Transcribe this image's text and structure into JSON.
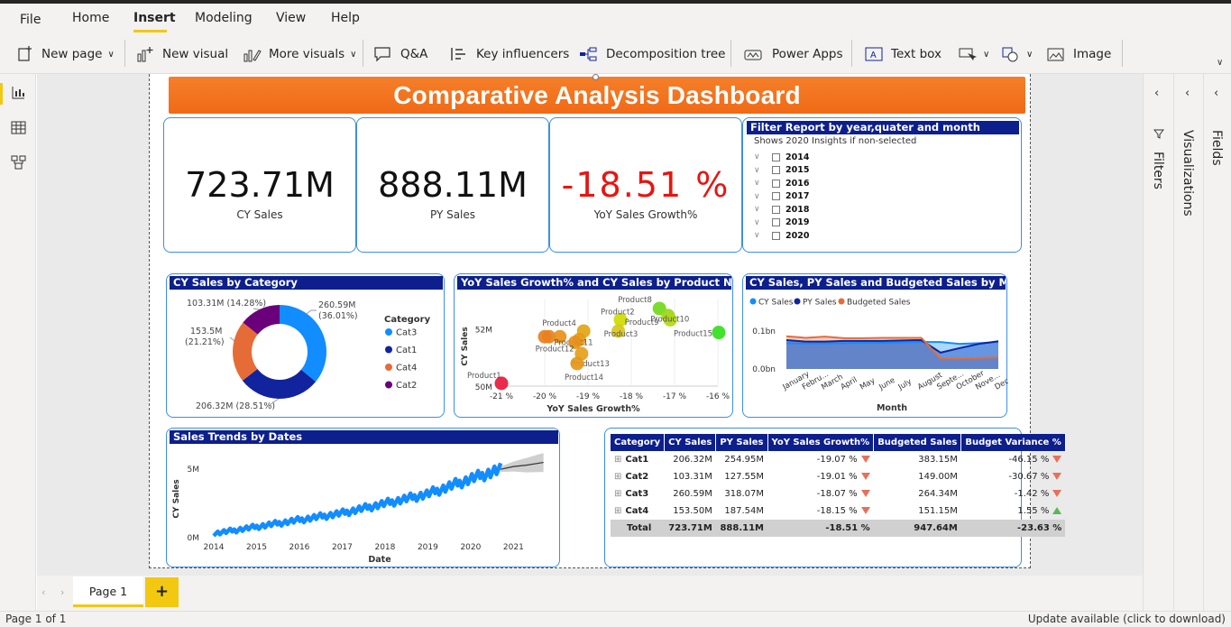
{
  "menu": {
    "file": "File",
    "home": "Home",
    "insert": "Insert",
    "modeling": "Modeling",
    "view": "View",
    "help": "Help"
  },
  "ribbon": {
    "new_page": "New page",
    "new_visual": "New visual",
    "more_visuals": "More visuals",
    "qa": "Q&A",
    "key_influencers": "Key influencers",
    "decomposition_tree": "Decomposition tree",
    "power_apps": "Power Apps",
    "text_box": "Text box",
    "image": "Image"
  },
  "dashboard": {
    "title": "Comparative Analysis Dashboard"
  },
  "kpis": {
    "cy": {
      "value": "723.71M",
      "label": "CY Sales"
    },
    "py": {
      "value": "888.11M",
      "label": "PY Sales"
    },
    "yoy": {
      "value": "-18.51 %",
      "label": "YoY Sales Growth%",
      "color": "#e8150f"
    }
  },
  "filter": {
    "title": "Filter Report by year,quater and month",
    "subtitle": "Shows 2020 Insights if non-selected",
    "years": [
      "2014",
      "2015",
      "2016",
      "2017",
      "2018",
      "2019",
      "2020"
    ]
  },
  "donut": {
    "title": "CY Sales by Category",
    "legend_title": "Category",
    "labels": {
      "cat2_a": "103.31M (14.28%)",
      "cat3_a": "260.59M",
      "cat3_b": "(36.01%)",
      "cat4_a": "153.5M",
      "cat4_b": "(21.21%)",
      "cat1_a": "206.32M (28.51%)"
    }
  },
  "scatter": {
    "title": "YoY Sales Growth% and CY Sales by Product Name",
    "xlabel": "YoY Sales Growth%",
    "ylabel": "CY Sales"
  },
  "area": {
    "title": "CY Sales, PY Sales and Budgeted Sales by Month",
    "xlabel": "Month"
  },
  "line": {
    "title": "Sales Trends by Dates",
    "xlabel": "Date",
    "ylabel": "CY Sales"
  },
  "chart_data": [
    {
      "type": "pie",
      "categories": [
        "Cat3",
        "Cat1",
        "Cat4",
        "Cat2"
      ],
      "values": [
        260.59,
        206.32,
        153.5,
        103.31
      ],
      "percents": [
        36.01,
        28.51,
        21.21,
        14.28
      ],
      "colors": [
        "#118dff",
        "#12239e",
        "#e66c37",
        "#6b007b"
      ],
      "title": "CY Sales by Category",
      "legend_title": "Category"
    },
    {
      "type": "scatter",
      "title": "YoY Sales Growth% and CY Sales by Product Name",
      "xlabel": "YoY Sales Growth%",
      "ylabel": "CY Sales",
      "xticks": [
        "-21 %",
        "-20 %",
        "-19 %",
        "-18 %",
        "-17 %",
        "-16 %"
      ],
      "yticks": [
        "50M",
        "52M"
      ],
      "xlim": [
        -21,
        -16
      ],
      "ylim": [
        50,
        53.1
      ],
      "points": [
        {
          "name": "Product1",
          "x": -21.0,
          "y": 50.1,
          "color": "#e8193c",
          "label": true
        },
        {
          "name": "Product2",
          "x": -18.25,
          "y": 52.35,
          "color": "#cddc00",
          "label": true
        },
        {
          "name": "Product3",
          "x": -18.3,
          "y": 51.95,
          "color": "#d9c51c",
          "label": true
        },
        {
          "name": "Product4",
          "x": -19.1,
          "y": 51.95,
          "color": "#e2a616",
          "label": true
        },
        {
          "name": "Product5",
          "x": -20.0,
          "y": 51.75,
          "color": "#e8801f",
          "label": false
        },
        {
          "name": "Product6",
          "x": -19.9,
          "y": 51.75,
          "color": "#e8801f",
          "label": false
        },
        {
          "name": "Product7",
          "x": -19.65,
          "y": 51.75,
          "color": "#e8901a",
          "label": false
        },
        {
          "name": "Product8",
          "x": -17.35,
          "y": 52.75,
          "color": "#70d91a",
          "label": true
        },
        {
          "name": "Product9",
          "x": -17.15,
          "y": 52.5,
          "color": "#9ad61a",
          "label": true
        },
        {
          "name": "Product10",
          "x": -17.1,
          "y": 52.35,
          "color": "#b2d719",
          "label": true
        },
        {
          "name": "Product11",
          "x": -19.2,
          "y": 51.65,
          "color": "#e59a18",
          "label": true
        },
        {
          "name": "Product12",
          "x": -19.3,
          "y": 51.55,
          "color": "#e8901a",
          "label": true
        },
        {
          "name": "Product13",
          "x": -19.15,
          "y": 51.15,
          "color": "#e59f18",
          "label": true
        },
        {
          "name": "Product14",
          "x": -19.25,
          "y": 50.8,
          "color": "#e59818",
          "label": true
        },
        {
          "name": "Product15",
          "x": -15.95,
          "y": 51.9,
          "color": "#33e01c",
          "label": true
        }
      ]
    },
    {
      "type": "area",
      "title": "CY Sales, PY Sales and Budgeted Sales by Month",
      "categories": [
        "January",
        "Febru...",
        "March",
        "April",
        "May",
        "June",
        "July",
        "August",
        "Septe...",
        "October",
        "Nove...",
        "Dece..."
      ],
      "yticks": [
        "0.0bn",
        "0.1bn"
      ],
      "ylim": [
        0,
        0.14
      ],
      "series": [
        {
          "name": "CY Sales",
          "color": "#118dff",
          "values": [
            0.068,
            0.067,
            0.067,
            0.068,
            0.069,
            0.069,
            0.07,
            0.071,
            0.071,
            0.066,
            0.068,
            0.071
          ]
        },
        {
          "name": "PY Sales",
          "color": "#12239e",
          "values": [
            0.076,
            0.072,
            0.072,
            0.074,
            0.074,
            0.074,
            0.075,
            0.076,
            0.043,
            0.055,
            0.066,
            0.073
          ]
        },
        {
          "name": "Budgeted Sales",
          "color": "#e66c37",
          "values": [
            0.086,
            0.082,
            0.085,
            0.081,
            0.081,
            0.082,
            0.082,
            0.082,
            0.028,
            0.028,
            0.029,
            0.031
          ]
        }
      ],
      "xlabel": "Month"
    },
    {
      "type": "line",
      "title": "Sales Trends by Dates",
      "xlabel": "Date",
      "ylabel": "CY Sales",
      "xticks": [
        "2014",
        "2015",
        "2016",
        "2017",
        "2018",
        "2019",
        "2020",
        "2021"
      ],
      "yticks": [
        "0M",
        "5M"
      ],
      "series": [
        {
          "name": "CY Sales",
          "color": "#118dff",
          "x": [
            2014.0,
            2015.0,
            2016.0,
            2017.0,
            2018.0,
            2019.0,
            2020.0,
            2020.7
          ],
          "values": [
            0.3,
            0.8,
            1.3,
            1.8,
            2.5,
            3.2,
            4.3,
            5.0
          ]
        },
        {
          "name": "Forecast",
          "color": "#333333",
          "x": [
            2020.7,
            2021.0,
            2021.3,
            2021.7
          ],
          "values": [
            5.0,
            5.2,
            5.3,
            5.5
          ]
        }
      ]
    },
    {
      "type": "table",
      "columns": [
        "Category",
        "CY Sales",
        "PY Sales",
        "YoY Sales Growth%",
        "Budgeted Sales",
        "Budget Variance %"
      ],
      "rows": [
        {
          "cat": "Cat1",
          "cy": "206.32M",
          "py": "254.95M",
          "yoy": "-19.07 %",
          "bud": "383.15M",
          "var": "-46.15 %",
          "var_up": false
        },
        {
          "cat": "Cat2",
          "cy": "103.31M",
          "py": "127.55M",
          "yoy": "-19.01 %",
          "bud": "149.00M",
          "var": "-30.67 %",
          "var_up": false
        },
        {
          "cat": "Cat3",
          "cy": "260.59M",
          "py": "318.07M",
          "yoy": "-18.07 %",
          "bud": "264.34M",
          "var": "-1.42 %",
          "var_up": false
        },
        {
          "cat": "Cat4",
          "cy": "153.50M",
          "py": "187.54M",
          "yoy": "-18.15 %",
          "bud": "151.15M",
          "var": "1.55 %",
          "var_up": true
        }
      ],
      "total": {
        "cat": "Total",
        "cy": "723.71M",
        "py": "888.11M",
        "yoy": "-18.51 %",
        "bud": "947.64M",
        "var": "-23.63 %"
      }
    }
  ],
  "panes": {
    "filters": "Filters",
    "visualizations": "Visualizations",
    "fields": "Fields"
  },
  "pages": {
    "tab": "Page 1",
    "add": "+"
  },
  "status": {
    "left": "Page 1 of 1",
    "right": "Update available (click to download)"
  }
}
